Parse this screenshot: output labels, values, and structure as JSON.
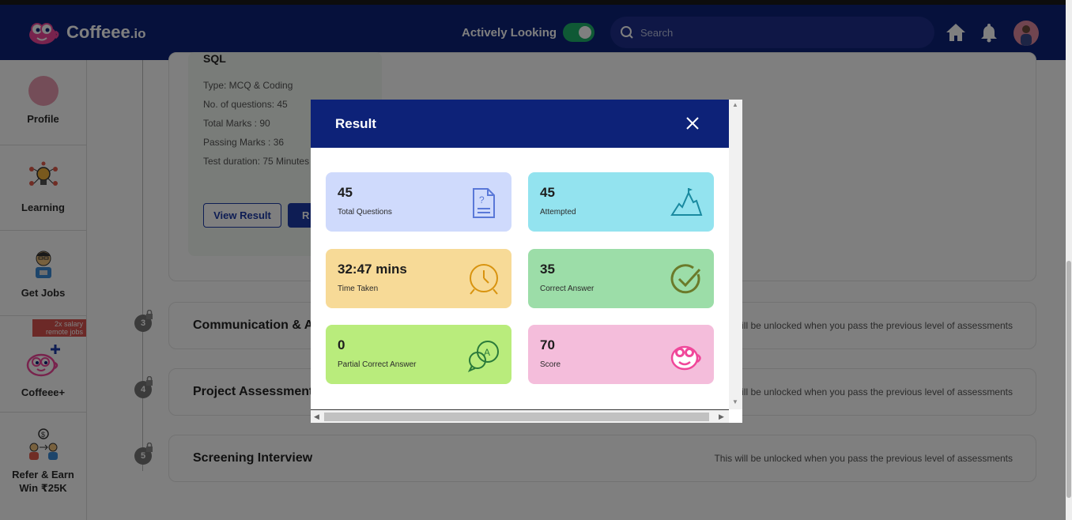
{
  "header": {
    "brand": "Coffeee",
    "brand_suffix": ".io",
    "active_label": "Actively Looking",
    "search_placeholder": "Search",
    "icons": [
      "home-icon",
      "bell-icon"
    ]
  },
  "sidebar": {
    "items": [
      {
        "label": "Profile"
      },
      {
        "label": "Learning"
      },
      {
        "label": "Get Jobs"
      },
      {
        "label": "Coffeee+",
        "ribbon_line1": "2x salary",
        "ribbon_line2": "remote jobs"
      },
      {
        "label": "Refer & Earn",
        "label2": "Win ₹25K"
      }
    ]
  },
  "test_card": {
    "title": "SQL",
    "type": "Type: MCQ & Coding",
    "questions": "No. of questions: 45",
    "total_marks": "Total Marks : 90",
    "passing_marks": "Passing Marks : 36",
    "duration": "Test duration: 75 Minutes",
    "view_result": "View Result",
    "retake_partial": "R"
  },
  "levels": [
    {
      "num": "3",
      "title": "Communication & A",
      "note": "will be unlocked when you pass the previous level of assessments"
    },
    {
      "num": "4",
      "title": "Project Assessment",
      "note": "will be unlocked when you pass the previous level of assessments"
    },
    {
      "num": "5",
      "title": "Screening Interview",
      "note": "This will be unlocked when you pass the previous level of assessments"
    }
  ],
  "modal": {
    "title": "Result",
    "stats": [
      {
        "value": "45",
        "caption": "Total Questions",
        "color": "#cfdafc",
        "icon": "document-question-icon"
      },
      {
        "value": "45",
        "caption": "Attempted",
        "color": "#93e3ef",
        "icon": "mountain-icon"
      },
      {
        "value": "32:47 mins",
        "caption": "Time Taken",
        "color": "#f7da97",
        "icon": "clock-icon"
      },
      {
        "value": "35",
        "caption": "Correct Answer",
        "color": "#9cdda8",
        "icon": "check-circle-icon"
      },
      {
        "value": "0",
        "caption": "Partial Correct Answer",
        "color": "#b9ec7c",
        "icon": "chat-answer-icon"
      },
      {
        "value": "70",
        "caption": "Score",
        "color": "#f4bddb",
        "icon": "coffee-face-icon"
      }
    ]
  }
}
